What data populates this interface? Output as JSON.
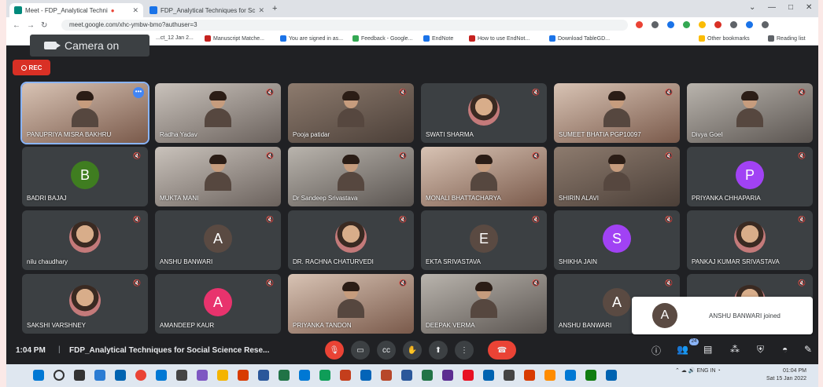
{
  "browser": {
    "tabs": [
      {
        "label": "Meet - FDP_Analytical Techni",
        "active": true
      },
      {
        "label": "FDP_Analytical Techniques for Sc",
        "active": false
      }
    ],
    "url": "meet.google.com/xhc-ymbw-bmo?authuser=3",
    "bookmarks": [
      "...ct_12 Jan 2...",
      "Manuscript Matche...",
      "You are signed in as...",
      "Feedback - Google...",
      "EndNote",
      "How to use EndNot...",
      "Download TableGD...",
      "Other bookmarks",
      "Reading list"
    ]
  },
  "camera_tooltip": "Camera on",
  "rec_label": "REC",
  "participants": [
    {
      "name": "PANUPRIYA MISRA BAKHRU",
      "kind": "video",
      "style": "v4",
      "active": true
    },
    {
      "name": "Radha Yadav",
      "kind": "video",
      "style": "v2"
    },
    {
      "name": "Pooja patidar",
      "kind": "video",
      "style": "video"
    },
    {
      "name": "SWATI SHARMA",
      "kind": "photo"
    },
    {
      "name": "SUMEET BHATIA PGP10097",
      "kind": "video",
      "style": "v4"
    },
    {
      "name": "Divya Goel",
      "kind": "video",
      "style": "v3"
    },
    {
      "name": "BADRI BAJAJ",
      "kind": "letter",
      "letter": "B",
      "color": "#3f7d20"
    },
    {
      "name": "MUKTA MANI",
      "kind": "video",
      "style": "v2"
    },
    {
      "name": "Dr Sandeep Srivastava",
      "kind": "video",
      "style": "v3"
    },
    {
      "name": "MONALI BHATTACHARYA",
      "kind": "video",
      "style": "v4"
    },
    {
      "name": "SHIRIN ALAVI",
      "kind": "video",
      "style": "video"
    },
    {
      "name": "PRIYANKA CHHAPARIA",
      "kind": "letter",
      "letter": "P",
      "color": "#a142f4"
    },
    {
      "name": "nilu chaudhary",
      "kind": "photo"
    },
    {
      "name": "ANSHU BANWARI",
      "kind": "letter",
      "letter": "A",
      "color": "#5a4a42"
    },
    {
      "name": "DR. RACHNA CHATURVEDI",
      "kind": "photo"
    },
    {
      "name": "EKTA SRIVASTAVA",
      "kind": "letter",
      "letter": "E",
      "color": "#5a4a42"
    },
    {
      "name": "SHIKHA JAIN",
      "kind": "letter",
      "letter": "S",
      "color": "#a142f4"
    },
    {
      "name": "PANKAJ KUMAR SRIVASTAVA",
      "kind": "photo"
    },
    {
      "name": "SAKSHI VARSHNEY",
      "kind": "photo"
    },
    {
      "name": "AMANDEEP KAUR",
      "kind": "letter",
      "letter": "A",
      "color": "#e8336d"
    },
    {
      "name": "PRIYANKA TANDON",
      "kind": "video",
      "style": "v4"
    },
    {
      "name": "DEEPAK VERMA",
      "kind": "video",
      "style": "v3"
    },
    {
      "name": "ANSHU BANWARI",
      "kind": "letter",
      "letter": "A",
      "color": "#5a4a42"
    },
    {
      "name": "",
      "kind": "photo"
    }
  ],
  "toast": {
    "letter": "A",
    "message": "ANSHU BANWARI joined"
  },
  "meeting": {
    "time": "1:04 PM",
    "separator": "|",
    "title": "FDP_Analytical Techniques for Social Science Rese..."
  },
  "participant_count": "24",
  "taskbar": {
    "tray_lang": "ENG IN",
    "clock_time": "01:04 PM",
    "clock_date": "Sat 15 Jan 2022"
  },
  "colors": {
    "accent": "#8ab4f8",
    "danger": "#ea4335",
    "surface": "#3c4043",
    "background": "#202124"
  }
}
